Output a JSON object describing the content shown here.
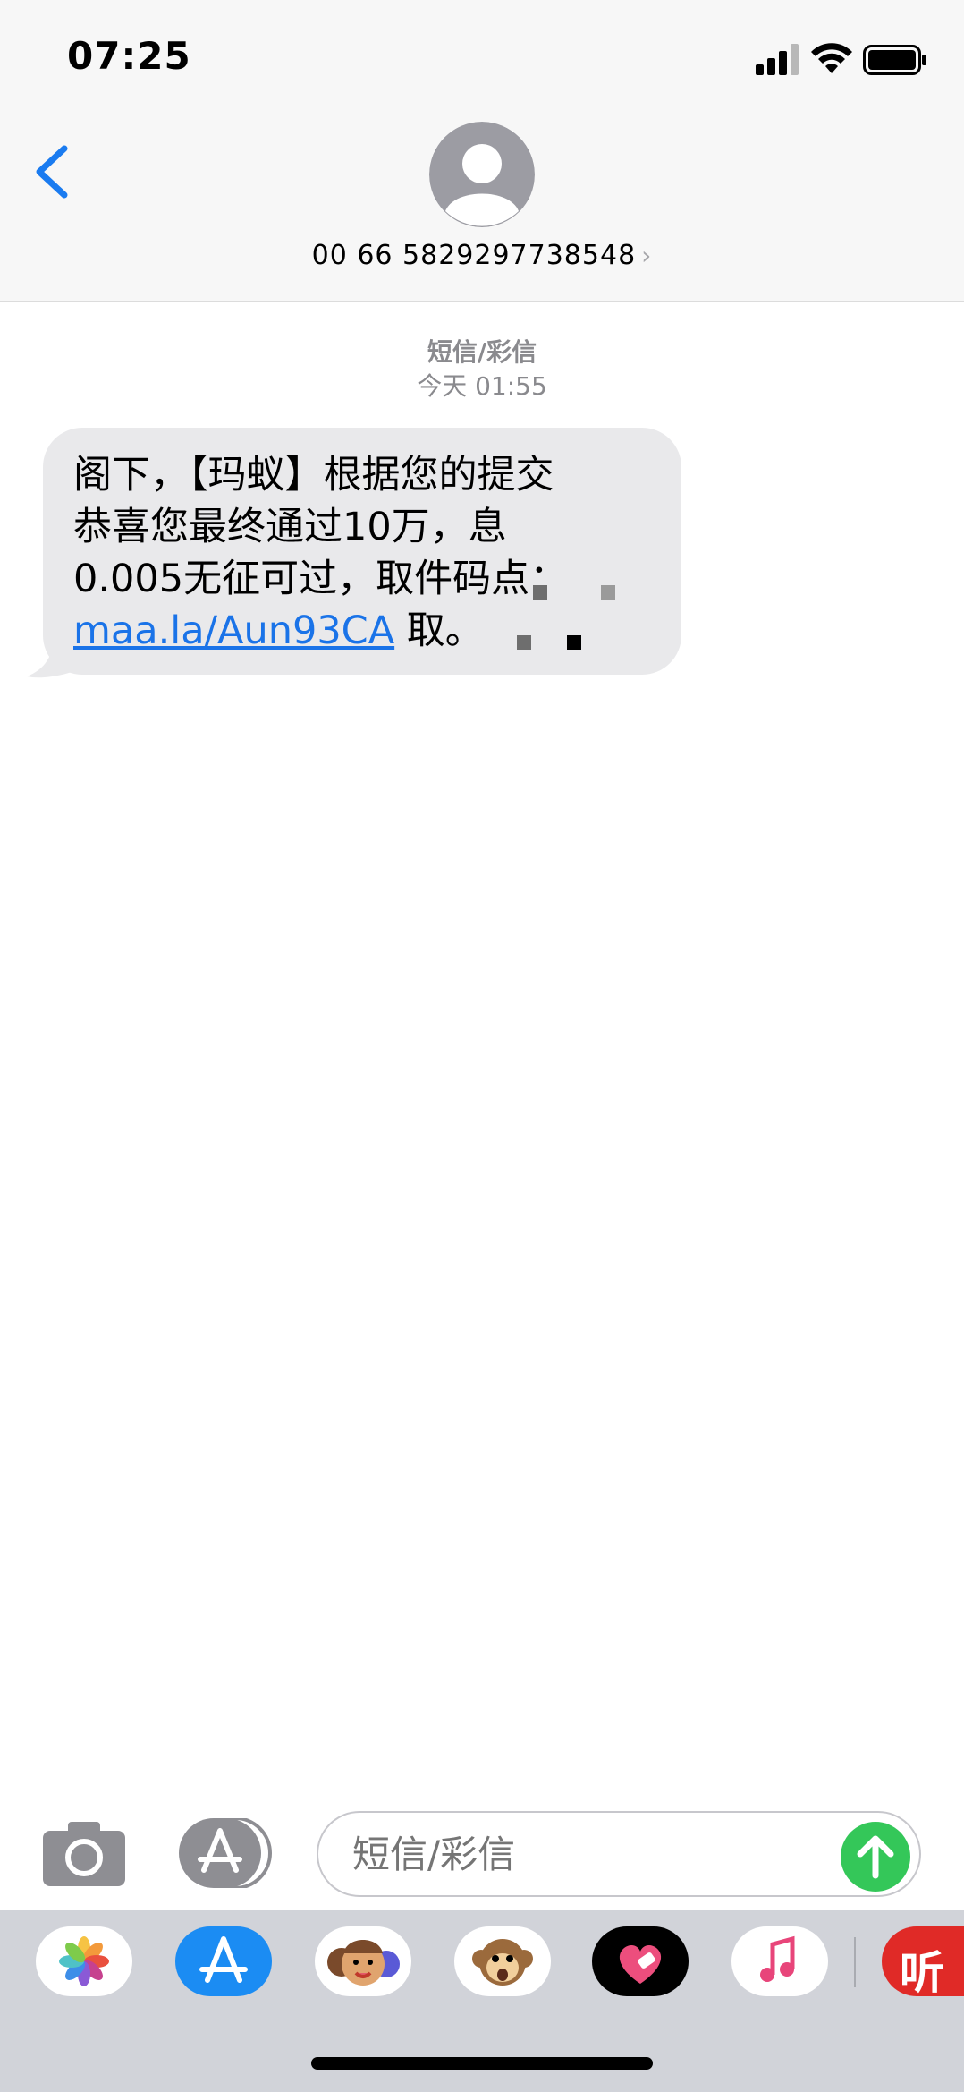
{
  "status_bar": {
    "time": "07:25",
    "icons": [
      "signal-icon",
      "wifi-icon",
      "battery-icon"
    ]
  },
  "header": {
    "back_icon": "chevron-left-icon",
    "avatar_icon": "person-avatar-icon",
    "contact_number": "00 66 5829297738548",
    "contact_chevron": "›"
  },
  "thread": {
    "type_label": "短信/彩信",
    "timestamp": "今天 01:55"
  },
  "message": {
    "text": "阁下，【玛蚁】根据您的提交\n恭喜您最终通过10万，息\n0.005无征可过，取件码点：",
    "link": "maa.la/Aun93CA",
    "suffix": " 取。"
  },
  "input_bar": {
    "camera_icon": "camera-icon",
    "appstore_icon": "app-store-icon",
    "placeholder": "短信/彩信",
    "send_icon": "arrow-up-icon"
  },
  "app_drawer": {
    "apps": [
      "photos-icon",
      "app-store-icon",
      "memoji-icon",
      "animoji-monkey-icon",
      "digital-touch-heart-icon",
      "music-icon",
      "listen-app-icon"
    ],
    "listen_label": "听"
  },
  "colors": {
    "accent_blue": "#1a73e8",
    "send_green": "#34c759",
    "bubble_gray": "#e9e9eb",
    "header_bg": "#f7f7f7",
    "drawer_bg": "#d1d3d9"
  }
}
